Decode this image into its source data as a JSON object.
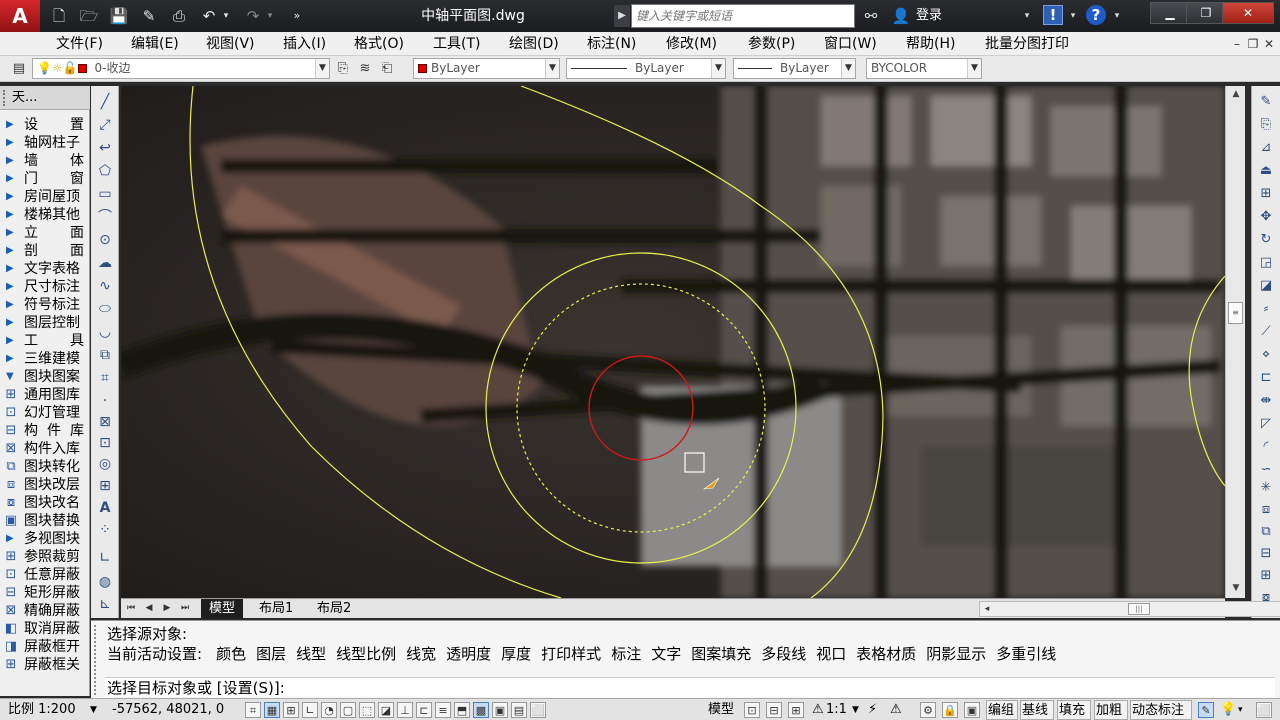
{
  "titlebar": {
    "logo_letter": "A",
    "document_title": "中轴平面图.dwg",
    "search_placeholder": "键入关键字或短语",
    "login_label": "登录"
  },
  "menu": {
    "items": [
      "文件(F)",
      "编辑(E)",
      "视图(V)",
      "插入(I)",
      "格式(O)",
      "工具(T)",
      "绘图(D)",
      "标注(N)",
      "修改(M)",
      "参数(P)",
      "窗口(W)",
      "帮助(H)",
      "批量分图打印"
    ]
  },
  "properties": {
    "layer_value": "0-收边",
    "color_value": "ByLayer",
    "linetype_value": "ByLayer",
    "lineweight_value": "ByLayer",
    "plotstyle_value": "BYCOLOR"
  },
  "left_panel": {
    "header": "天...",
    "items": [
      {
        "label": "设置",
        "spread": true,
        "kind": "tri"
      },
      {
        "label": "轴网柱子",
        "spread": false,
        "kind": "tri"
      },
      {
        "label": "墙体",
        "spread": true,
        "kind": "tri"
      },
      {
        "label": "门窗",
        "spread": true,
        "kind": "tri"
      },
      {
        "label": "房间屋顶",
        "spread": false,
        "kind": "tri"
      },
      {
        "label": "楼梯其他",
        "spread": false,
        "kind": "tri"
      },
      {
        "label": "立面",
        "spread": true,
        "kind": "tri"
      },
      {
        "label": "剖面",
        "spread": true,
        "kind": "tri"
      },
      {
        "label": "文字表格",
        "spread": false,
        "kind": "tri"
      },
      {
        "label": "尺寸标注",
        "spread": false,
        "kind": "tri"
      },
      {
        "label": "符号标注",
        "spread": false,
        "kind": "tri"
      },
      {
        "label": "图层控制",
        "spread": false,
        "kind": "tri"
      },
      {
        "label": "工具",
        "spread": true,
        "kind": "tri"
      },
      {
        "label": "三维建模",
        "spread": false,
        "kind": "tri"
      },
      {
        "label": "图块图案",
        "spread": false,
        "kind": "open"
      },
      {
        "label": "通用图库",
        "spread": false,
        "kind": "icon"
      },
      {
        "label": "幻灯管理",
        "spread": false,
        "kind": "icon"
      },
      {
        "label": "构件库",
        "spread": true,
        "kind": "icon"
      },
      {
        "label": "构件入库",
        "spread": false,
        "kind": "icon"
      },
      {
        "label": "图块转化",
        "spread": false,
        "kind": "icon"
      },
      {
        "label": "图块改层",
        "spread": false,
        "kind": "icon"
      },
      {
        "label": "图块改名",
        "spread": false,
        "kind": "icon"
      },
      {
        "label": "图块替换",
        "spread": false,
        "kind": "icon"
      },
      {
        "label": "多视图块",
        "spread": false,
        "kind": "tri"
      },
      {
        "label": "参照裁剪",
        "spread": false,
        "kind": "icon"
      },
      {
        "label": "任意屏蔽",
        "spread": false,
        "kind": "icon"
      },
      {
        "label": "矩形屏蔽",
        "spread": false,
        "kind": "icon"
      },
      {
        "label": "精确屏蔽",
        "spread": false,
        "kind": "icon"
      },
      {
        "label": "取消屏蔽",
        "spread": false,
        "kind": "icon"
      },
      {
        "label": "屏蔽框开",
        "spread": false,
        "kind": "icon"
      },
      {
        "label": "屏蔽框关",
        "spread": false,
        "kind": "icon"
      }
    ]
  },
  "layout_tabs": {
    "model": "模型",
    "layout1": "布局1",
    "layout2": "布局2"
  },
  "command": {
    "line1": "选择源对象:",
    "line2_prefix": "当前活动设置:",
    "settings": [
      "颜色",
      "图层",
      "线型",
      "线型比例",
      "线宽",
      "透明度",
      "厚度",
      "打印样式",
      "标注",
      "文字",
      "图案填充",
      "多段线",
      "视口",
      "表格材质",
      "阴影显示",
      "多重引线"
    ],
    "prompt": "选择目标对象或 [设置(S)]:"
  },
  "status": {
    "scale": "比例 1:200",
    "coords": "-57562, 48021, 0",
    "model_label": "模型",
    "annotation_scale": "1:1",
    "right_buttons": [
      "编组",
      "基线",
      "填充",
      "加粗",
      "动态标注"
    ]
  },
  "colors": {
    "accent_red": "#e00000",
    "circle_yellow": "#e8f04a",
    "circle_red": "#d01818"
  }
}
